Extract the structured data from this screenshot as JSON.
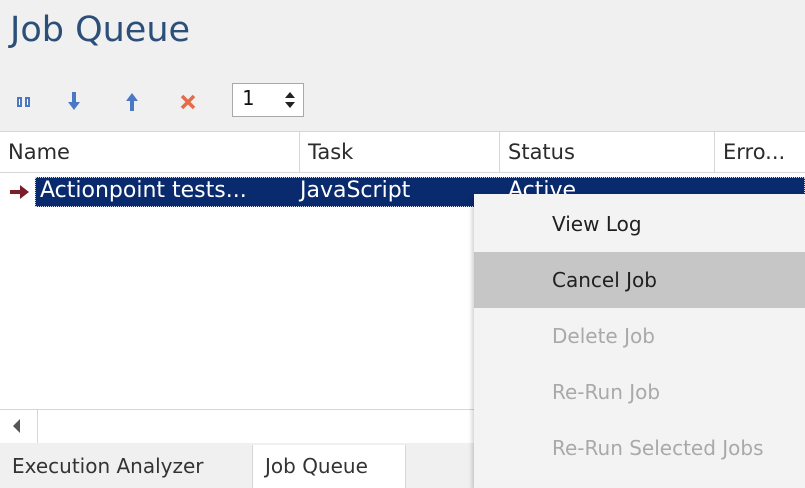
{
  "panel": {
    "title": "Job Queue"
  },
  "toolbar": {
    "spinner_value": "1",
    "icons": [
      "pause-icon",
      "move-down-icon",
      "move-up-icon",
      "delete-icon"
    ],
    "colors": {
      "blue": "#4a78c5",
      "red": "#e66b4b"
    }
  },
  "grid": {
    "columns": [
      "Name",
      "Task",
      "Status",
      "Erro..."
    ],
    "rows": [
      {
        "name": "Actionpoint tests...",
        "task": "JavaScript",
        "status": "Active",
        "error": ""
      }
    ],
    "selection_color": "#0a2a6e"
  },
  "context_menu": {
    "items": [
      {
        "label": "View Log",
        "state": "normal"
      },
      {
        "label": "Cancel Job",
        "state": "hover"
      },
      {
        "label": "Delete Job",
        "state": "disabled"
      },
      {
        "label": "Re-Run Job",
        "state": "disabled"
      },
      {
        "label": "Re-Run Selected Jobs",
        "state": "disabled"
      }
    ]
  },
  "tabs": [
    {
      "label": "Execution Analyzer",
      "active": false
    },
    {
      "label": "Job Queue",
      "active": true
    }
  ]
}
